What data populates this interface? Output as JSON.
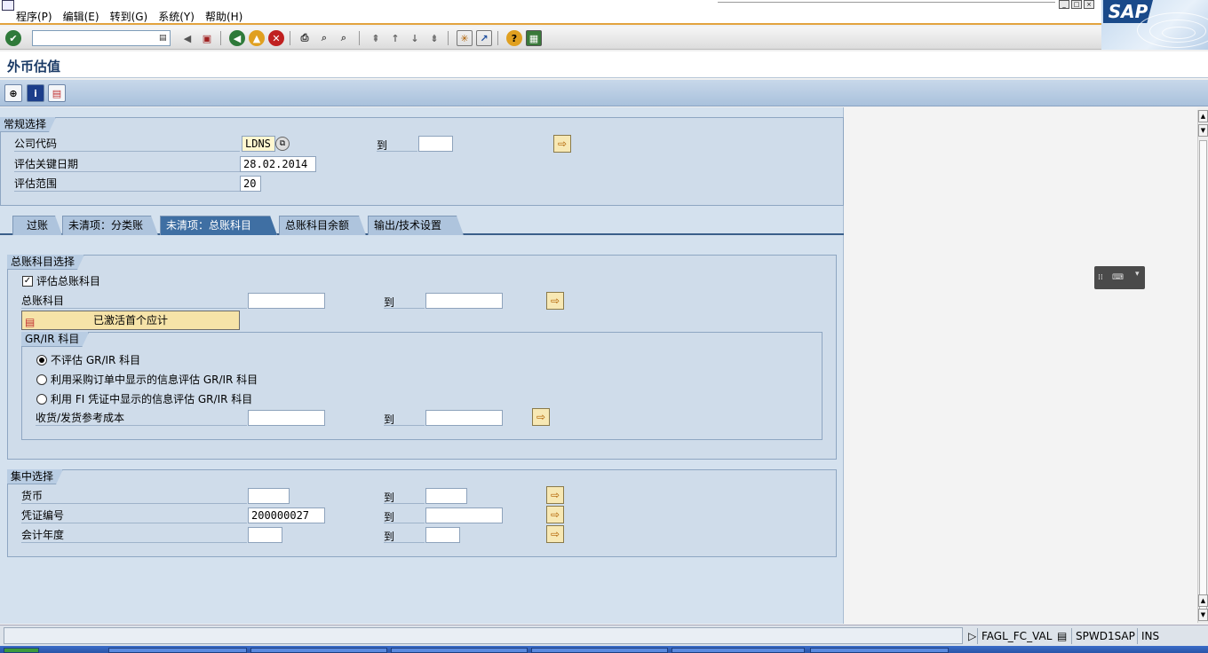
{
  "menu": [
    "程序(P)",
    "编辑(E)",
    "转到(G)",
    "系统(Y)",
    "帮助(H)"
  ],
  "logo": "SAP",
  "title": "外币估值",
  "general": {
    "caption": "常规选择",
    "company_label": "公司代码",
    "company_value": "LDNS",
    "to_label": "到",
    "key_date_label": "评估关键日期",
    "key_date_value": "28.02.2014",
    "area_label": "评估范围",
    "area_value": "20"
  },
  "tabs": [
    "过账",
    "未清项：分类账",
    "未清项：总账科目",
    "总账科目余额",
    "输出/技术设置"
  ],
  "gl": {
    "caption": "总账科目选择",
    "eval_checkbox_label": "评估总账科目",
    "eval_checked": true,
    "account_label": "总账科目",
    "to_label": "到",
    "first_acct_button": "已激活首个应计",
    "grir": {
      "caption": "GR/IR 科目",
      "options": [
        "不评估 GR/IR 科目",
        "利用采购订单中显示的信息评估 GR/IR 科目",
        "利用 FI 凭证中显示的信息评估 GR/IR 科目"
      ],
      "selected": 0,
      "cost_label": "收货/发货参考成本",
      "to_label": "到"
    }
  },
  "focused": {
    "caption": "集中选择",
    "currency_label": "货币",
    "docno_label": "凭证编号",
    "docno_value": "200000027",
    "year_label": "会计年度",
    "to_label": "到"
  },
  "status": {
    "tcode": "FAGL_FC_VAL",
    "server": "SPWD1SAP",
    "mode": "INS"
  }
}
